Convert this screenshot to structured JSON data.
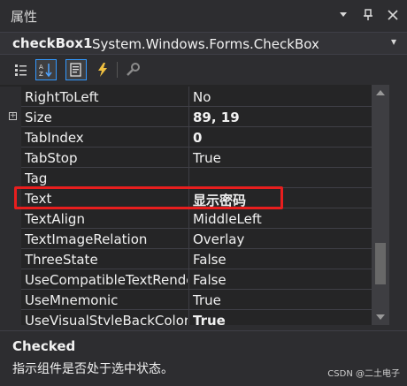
{
  "window": {
    "title": "属性",
    "controls": [
      "dropdown",
      "pin",
      "close"
    ]
  },
  "object_selector": {
    "name": "checkBox1",
    "type": "System.Windows.Forms.CheckBox"
  },
  "toolbar": {
    "buttons": [
      {
        "icon": "categorized-icon",
        "active": false
      },
      {
        "icon": "alphabetical-icon",
        "active": true
      },
      {
        "icon": "properties-icon",
        "active": true
      },
      {
        "icon": "events-icon",
        "active": false
      },
      {
        "icon": "property-pages-icon",
        "active": false
      }
    ]
  },
  "grid": {
    "rows": [
      {
        "name": "RightToLeft",
        "value": "No",
        "bold": false,
        "expandable": false
      },
      {
        "name": "Size",
        "value": "89, 19",
        "bold": true,
        "expandable": true
      },
      {
        "name": "TabIndex",
        "value": "0",
        "bold": true,
        "expandable": false
      },
      {
        "name": "TabStop",
        "value": "True",
        "bold": false,
        "expandable": false
      },
      {
        "name": "Tag",
        "value": "",
        "bold": false,
        "expandable": false
      },
      {
        "name": "Text",
        "value": "显示密码",
        "bold": true,
        "expandable": false,
        "highlighted": true
      },
      {
        "name": "TextAlign",
        "value": "MiddleLeft",
        "bold": false,
        "expandable": false
      },
      {
        "name": "TextImageRelation",
        "value": "Overlay",
        "bold": false,
        "expandable": false
      },
      {
        "name": "ThreeState",
        "value": "False",
        "bold": false,
        "expandable": false
      },
      {
        "name": "UseCompatibleTextRendering",
        "value": "False",
        "bold": false,
        "expandable": false
      },
      {
        "name": "UseMnemonic",
        "value": "True",
        "bold": false,
        "expandable": false
      },
      {
        "name": "UseVisualStyleBackColor",
        "value": "True",
        "bold": true,
        "expandable": false
      }
    ]
  },
  "scrollbar": {
    "position": 0.85,
    "visible_fraction": 0.2
  },
  "description": {
    "title": "Checked",
    "text": "指示组件是否处于选中状态。"
  },
  "watermark": "CSDN @二土电子",
  "colors": {
    "background": "#2d2d30",
    "grid": "#252526",
    "highlight_border": "#e81e1e",
    "active_button_border": "#3399ff"
  }
}
